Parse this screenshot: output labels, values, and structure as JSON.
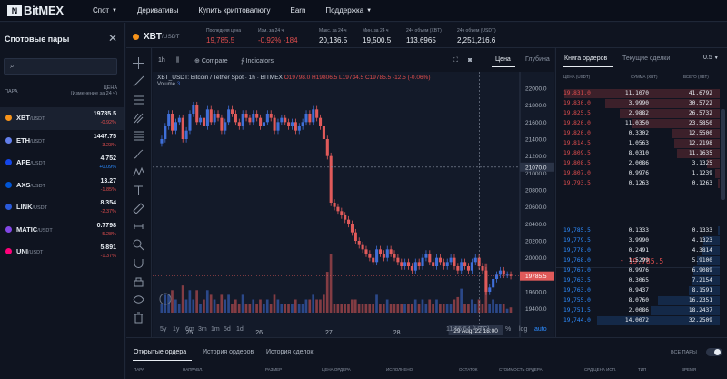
{
  "nav": {
    "logo_mark": "N",
    "logo_text": "BitMEX",
    "items": [
      {
        "label": "Спот",
        "chevron": true
      },
      {
        "label": "Деривативы",
        "chevron": false
      },
      {
        "label": "Купить криптовалюту",
        "chevron": false
      },
      {
        "label": "Earn",
        "chevron": false
      },
      {
        "label": "Поддержка",
        "chevron": true
      }
    ]
  },
  "sidebar": {
    "title": "Спотовые пары",
    "col_pair": "ПАРА",
    "col_price": "ЦЕНА",
    "col_price_sub": "(Изменение за 24 ч)",
    "pairs": [
      {
        "base": "XBT",
        "quote": "/USDT",
        "price": "19785.5",
        "change": "-0.92%",
        "dir": "neg",
        "color": "#f7931a",
        "active": true
      },
      {
        "base": "ETH",
        "quote": "/USDT",
        "price": "1447.75",
        "change": "-3.23%",
        "dir": "neg",
        "color": "#627eea",
        "active": false
      },
      {
        "base": "APE",
        "quote": "/USDT",
        "price": "4.752",
        "change": "+0.09%",
        "dir": "pos",
        "color": "#1446ea",
        "active": false
      },
      {
        "base": "AXS",
        "quote": "/USDT",
        "price": "13.27",
        "change": "-1.85%",
        "dir": "neg",
        "color": "#0055d5",
        "active": false
      },
      {
        "base": "LINK",
        "quote": "/USDT",
        "price": "8.354",
        "change": "-2.37%",
        "dir": "neg",
        "color": "#2a5ada",
        "active": false
      },
      {
        "base": "MATIC",
        "quote": "/USDT",
        "price": "0.7798",
        "change": "-5.28%",
        "dir": "neg",
        "color": "#8247e5",
        "active": false
      },
      {
        "base": "UNI",
        "quote": "/USDT",
        "price": "5.891",
        "change": "-1.37%",
        "dir": "neg",
        "color": "#ff007a",
        "active": false
      }
    ]
  },
  "ticker": {
    "base": "XBT",
    "quote": "/USDT",
    "items": [
      {
        "label": "Последняя цена",
        "value": "19,785.5",
        "color": "#e04e4e"
      },
      {
        "label": "Изм. за 24 ч",
        "value": "-0.92%   -184",
        "color": "#e04e4e"
      },
      {
        "label": "Макс. за 24 ч",
        "value": "20,136.5",
        "color": "#e8edf3"
      },
      {
        "label": "Мин. за 24 ч",
        "value": "19,500.5",
        "color": "#e8edf3"
      },
      {
        "label": "24ч объем (XBT)",
        "value": "113.6965",
        "color": "#e8edf3"
      },
      {
        "label": "24ч объем (USDT)",
        "value": "2,251,216.6",
        "color": "#e8edf3"
      }
    ]
  },
  "chart_toolbar": {
    "interval": "1h",
    "compare": "Compare",
    "indicators": "Indicators",
    "tab_price": "Цена",
    "tab_depth": "Глубина"
  },
  "chart_legend": {
    "title": "XBT_USDT: Bitcoin / Tether Spot · 1h · BITMEX",
    "ohlc": "O19798.0  H19806.5  L19734.5  C19785.5  -12.5 (-0.06%)",
    "volume_label": "Volume",
    "volume_value": "3"
  },
  "timebar": {
    "ranges": [
      "5y",
      "1y",
      "6m",
      "3m",
      "1m",
      "5d",
      "1d"
    ],
    "clock": "11:55:54 (UTC)",
    "pct": "%",
    "log": "log",
    "auto": "auto"
  },
  "chart_data": {
    "type": "candlestick",
    "title": "XBT_USDT: Bitcoin / Tether Spot · 1h · BITMEX",
    "y_ticks": [
      "22000.0",
      "21800.0",
      "21600.0",
      "21400.0",
      "21200.0",
      "21000.0",
      "20800.0",
      "20600.0",
      "20400.0",
      "20200.0",
      "20000.0",
      "19800.0",
      "19600.0",
      "19400.0"
    ],
    "x_ticks": [
      "25",
      "26",
      "27",
      "28",
      "29",
      "29 Aug '22",
      "18:00"
    ],
    "ylim": [
      19300,
      22150
    ],
    "crosshair_label": "21070.0",
    "last_price_label": "19785.5",
    "x_cursor_label": "29 Aug '22  18:00",
    "closes": [
      21400,
      21550,
      21700,
      21500,
      21600,
      21650,
      21400,
      21500,
      21700,
      21800,
      21600,
      21650,
      21550,
      21750,
      21600,
      21700,
      21650,
      21500,
      21600,
      21750,
      21700,
      21600,
      21550,
      21700,
      21650,
      21600,
      21700,
      21650,
      21550,
      21600,
      21700,
      21650,
      21500,
      21600,
      21650,
      21600,
      21550,
      21600,
      21500,
      21550,
      21600,
      21700,
      21600,
      21750,
      21650,
      21550,
      21400,
      21200,
      20650,
      20600,
      20550,
      20500,
      20450,
      20400,
      20300,
      20200,
      20150,
      20100,
      20050,
      20000,
      19950,
      20100,
      20050,
      20000,
      20100,
      20050,
      20000,
      19950,
      19900,
      19950,
      19900,
      19850,
      19950,
      19900,
      20000,
      20050,
      19950,
      19900,
      20000,
      19950,
      19900,
      19950,
      20000,
      19900,
      19850,
      19950,
      19900,
      19850,
      19950,
      20000,
      19900,
      19850,
      19600,
      19650,
      19750,
      19800,
      19850,
      19800,
      19800,
      19785.5
    ]
  },
  "orderbook": {
    "tab_book": "Книга ордеров",
    "tab_trades": "Текущие сделки",
    "precision": "0.5",
    "col_price": "ЦЕНА (USDT)",
    "col_size": "СУММА (XBT)",
    "col_total": "ВСЕГО (XBT)",
    "asks": [
      {
        "price": "19,831.0",
        "size": "11.1070",
        "total": "41.6792",
        "depth": 0.95
      },
      {
        "price": "19,830.0",
        "size": "3.9990",
        "total": "30.5722",
        "depth": 0.7
      },
      {
        "price": "19,825.5",
        "size": "2.9882",
        "total": "26.5732",
        "depth": 0.61
      },
      {
        "price": "19,820.0",
        "size": "11.0350",
        "total": "23.5850",
        "depth": 0.54
      },
      {
        "price": "19,820.0",
        "size": "0.3302",
        "total": "12.5500",
        "depth": 0.29
      },
      {
        "price": "19,814.5",
        "size": "1.0563",
        "total": "12.2198",
        "depth": 0.28
      },
      {
        "price": "19,809.5",
        "size": "8.0310",
        "total": "11.1635",
        "depth": 0.26
      },
      {
        "price": "19,808.5",
        "size": "2.0086",
        "total": "3.1325",
        "depth": 0.08
      },
      {
        "price": "19,807.0",
        "size": "0.9976",
        "total": "1.1239",
        "depth": 0.03
      },
      {
        "price": "19,793.5",
        "size": "0.1263",
        "total": "0.1263",
        "depth": 0.01
      }
    ],
    "mid_price": "↑ 19,785.5",
    "bids": [
      {
        "price": "19,785.5",
        "size": "0.1333",
        "total": "0.1333",
        "depth": 0.01
      },
      {
        "price": "19,779.5",
        "size": "3.9990",
        "total": "4.1323",
        "depth": 0.1
      },
      {
        "price": "19,778.0",
        "size": "0.2491",
        "total": "4.3814",
        "depth": 0.11
      },
      {
        "price": "19,768.0",
        "size": "1.5299",
        "total": "5.9100",
        "depth": 0.14
      },
      {
        "price": "19,767.0",
        "size": "0.9976",
        "total": "6.9089",
        "depth": 0.16
      },
      {
        "price": "19,763.5",
        "size": "0.3065",
        "total": "7.2154",
        "depth": 0.17
      },
      {
        "price": "19,763.0",
        "size": "0.9437",
        "total": "8.1591",
        "depth": 0.19
      },
      {
        "price": "19,755.0",
        "size": "8.0760",
        "total": "16.2351",
        "depth": 0.38
      },
      {
        "price": "19,751.5",
        "size": "2.0086",
        "total": "18.2437",
        "depth": 0.42
      },
      {
        "price": "19,744.0",
        "size": "14.0072",
        "total": "32.2509",
        "depth": 0.75
      }
    ]
  },
  "bottom": {
    "tabs": [
      "Открытые ордера",
      "История ордеров",
      "История сделок"
    ],
    "all_pairs": "ВСЕ ПАРЫ",
    "columns": [
      "ПАРА",
      "НАПРАВЛ.",
      "РАЗМЕР",
      "ЦЕНА ОРДЕРА",
      "ИСПОЛНЕНО",
      "ОСТАТОК",
      "СТОИМОСТЬ ОРДЕРА",
      "СРД ЦЕНА ИСП.",
      "ТИП",
      "ВРЕМЯ"
    ]
  },
  "colors": {
    "up": "#3f6fd8",
    "down": "#e05a5a",
    "background": "#101624"
  }
}
